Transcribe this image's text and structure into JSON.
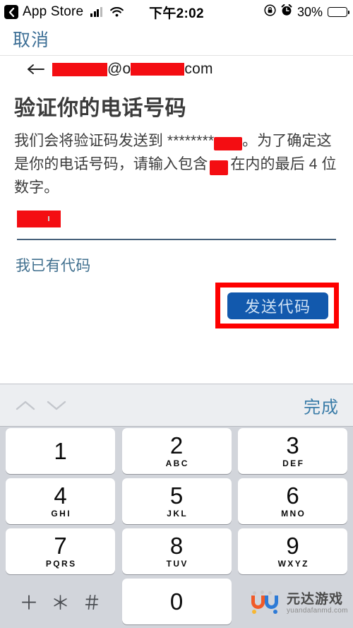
{
  "status_bar": {
    "back_app_label": "App Store",
    "back_icon": "chevron-left-icon",
    "signal_icon": "cellular-signal-icon",
    "wifi_icon": "wifi-icon",
    "time": "下午2:02",
    "rotation_lock_icon": "rotation-lock-icon",
    "alarm_icon": "alarm-clock-icon",
    "battery_percent": "30%",
    "battery_level": 30
  },
  "nav": {
    "cancel_label": "取消",
    "back_arrow_icon": "arrow-left-icon",
    "email_domain_suffix": "com",
    "email_at": "@",
    "email_domain_prefix": "",
    "redacted": true
  },
  "content": {
    "title": "验证你的电话号码",
    "body_part_1": "我们会将验证码发送到 ********",
    "body_part_2": "。为了确定这是你的电话号码，请输入包含",
    "body_part_3": "在内的最后 4 位数字。",
    "input": {
      "name": "verification-digits-input",
      "value": "",
      "placeholder": "",
      "redacted": true
    },
    "have_code_link": "我已有代码",
    "send_code_button": "发送代码"
  },
  "annotation": {
    "highlight_color": "#fe0000",
    "target": "send-code-button"
  },
  "colors": {
    "button_blue": "#1259ad",
    "link_blue": "#3d6f96",
    "redaction_red": "#f40d12",
    "keyboard_bg": "#d2d5db",
    "accessory_bg": "#eceef1"
  },
  "keyboard": {
    "accessory": {
      "prev_icon": "chevron-up-icon",
      "next_icon": "chevron-down-icon",
      "done_label": "完成"
    },
    "rows": [
      [
        {
          "num": "1",
          "sub": ""
        },
        {
          "num": "2",
          "sub": "ABC"
        },
        {
          "num": "3",
          "sub": "DEF"
        }
      ],
      [
        {
          "num": "4",
          "sub": "GHI"
        },
        {
          "num": "5",
          "sub": "JKL"
        },
        {
          "num": "6",
          "sub": "MNO"
        }
      ],
      [
        {
          "num": "7",
          "sub": "PQRS"
        },
        {
          "num": "8",
          "sub": "TUV"
        },
        {
          "num": "9",
          "sub": "WXYZ"
        }
      ],
      [
        {
          "num": "＋ ＊ ＃",
          "sub": "",
          "type": "symbols"
        },
        {
          "num": "0",
          "sub": ""
        },
        {
          "num": "",
          "sub": "",
          "type": "blank"
        }
      ]
    ]
  },
  "watermark": {
    "title": "元达游戏",
    "url": "yuandafanmd.com"
  }
}
